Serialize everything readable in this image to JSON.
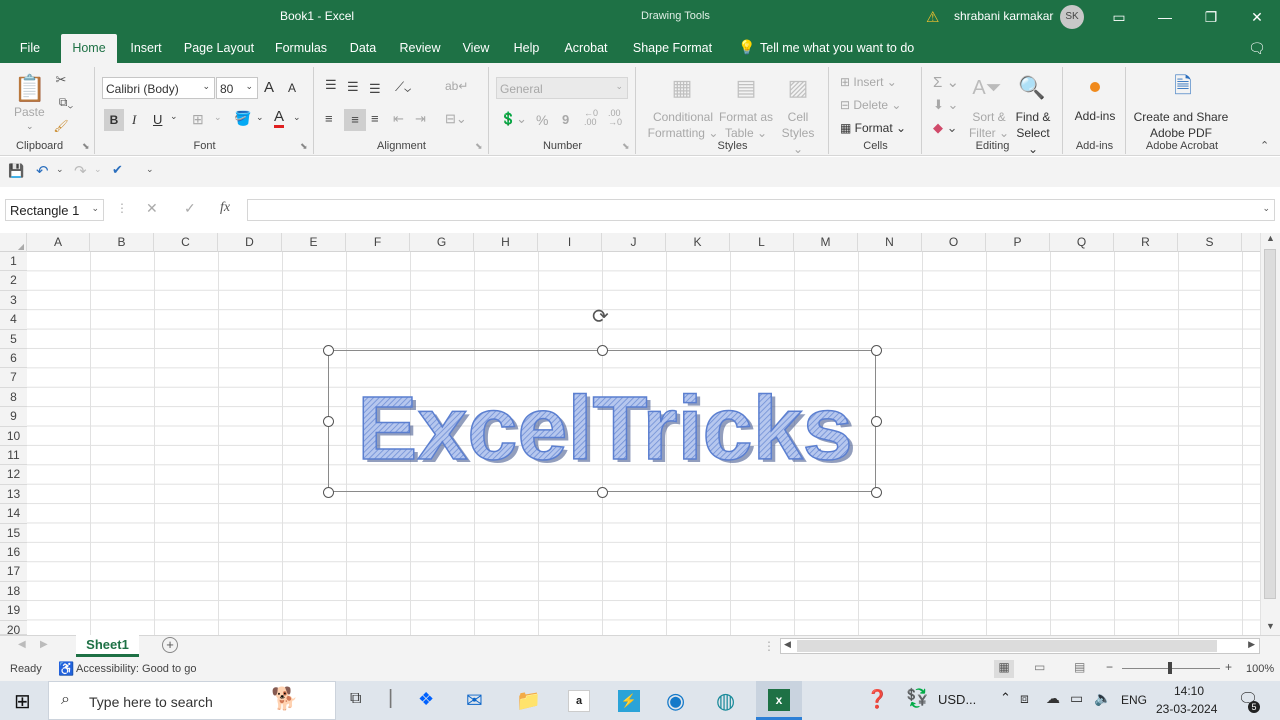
{
  "title": {
    "doc": "Book1  -  Excel",
    "context": "Drawing Tools",
    "user": "shrabani karmakar",
    "initials": "SK"
  },
  "tabs": [
    "File",
    "Home",
    "Insert",
    "Page Layout",
    "Formulas",
    "Data",
    "Review",
    "View",
    "Help",
    "Acrobat",
    "Shape Format"
  ],
  "tell_me": "Tell me what you want to do",
  "ribbon": {
    "clipboard": {
      "paste": "Paste",
      "label": "Clipboard"
    },
    "font": {
      "name": "Calibri (Body)",
      "size": "80",
      "bold": "B",
      "italic": "I",
      "underline": "U",
      "grow": "A",
      "shrink": "A",
      "label": "Font"
    },
    "alignment": {
      "label": "Alignment"
    },
    "number": {
      "format": "General",
      "pct": "%",
      "comma": "9",
      "label": "Number"
    },
    "styles": {
      "cond1": "Conditional",
      "cond2": "Formatting",
      "fmt1": "Format as",
      "fmt2": "Table",
      "cell1": "Cell",
      "cell2": "Styles",
      "label": "Styles"
    },
    "cells": {
      "insert": "Insert",
      "delete": "Delete",
      "format": "Format",
      "label": "Cells"
    },
    "editing": {
      "sort1": "Sort &",
      "sort2": "Filter",
      "find1": "Find &",
      "find2": "Select",
      "label": "Editing"
    },
    "addins": {
      "btn": "Add-ins",
      "label": "Add-ins"
    },
    "acrobat": {
      "btn1": "Create and Share",
      "btn2": "Adobe PDF",
      "label": "Adobe Acrobat"
    }
  },
  "formula_bar": {
    "name_box": "Rectangle 1",
    "fx": "fx",
    "value": ""
  },
  "columns": [
    "A",
    "B",
    "C",
    "D",
    "E",
    "F",
    "G",
    "H",
    "I",
    "J",
    "K",
    "L",
    "M",
    "N",
    "O",
    "P",
    "Q",
    "R",
    "S"
  ],
  "rows": [
    "1",
    "2",
    "3",
    "4",
    "5",
    "6",
    "7",
    "8",
    "9",
    "10",
    "11",
    "12",
    "13",
    "14",
    "15",
    "16",
    "17",
    "18",
    "19",
    "20"
  ],
  "shape": {
    "text": "ExcelTricks"
  },
  "sheet_tab": "Sheet1",
  "status": {
    "ready": "Ready",
    "accessibility": "Accessibility: Good to go",
    "zoom": "100%"
  },
  "taskbar": {
    "search": "Type here to search",
    "currency": "USD...",
    "lang": "ENG",
    "time": "14:10",
    "date": "23-03-2024",
    "notif": "5"
  },
  "colors": {
    "excel_green": "#1e7145",
    "shape_text": "#5b7fd0"
  }
}
